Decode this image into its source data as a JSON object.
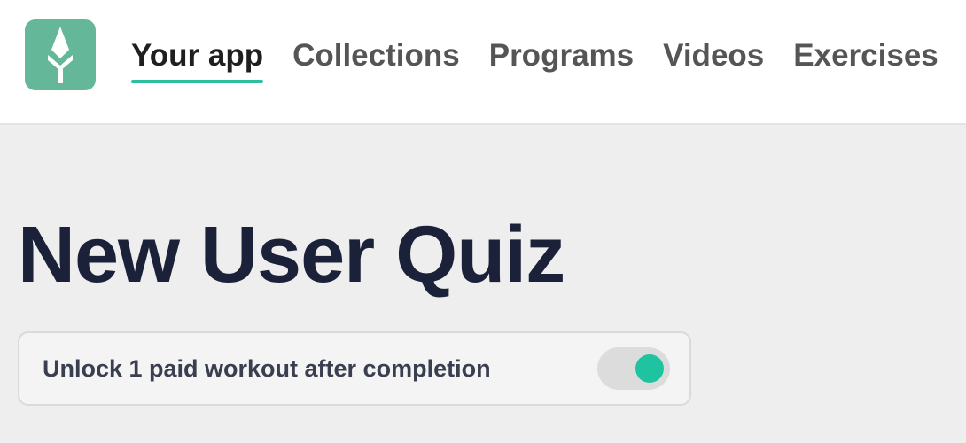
{
  "header": {
    "logo_icon": "spear-arrow-icon",
    "nav": [
      {
        "label": "Your app",
        "active": true
      },
      {
        "label": "Collections",
        "active": false
      },
      {
        "label": "Programs",
        "active": false
      },
      {
        "label": "Videos",
        "active": false
      },
      {
        "label": "Exercises",
        "active": false
      }
    ]
  },
  "main": {
    "title": "New User Quiz",
    "setting": {
      "label": "Unlock 1 paid workout after completion",
      "enabled": true
    }
  },
  "colors": {
    "logo_bg": "#64b899",
    "accent": "#2fbf9f",
    "toggle_on": "#1fc3a0",
    "title": "#1b2138"
  }
}
